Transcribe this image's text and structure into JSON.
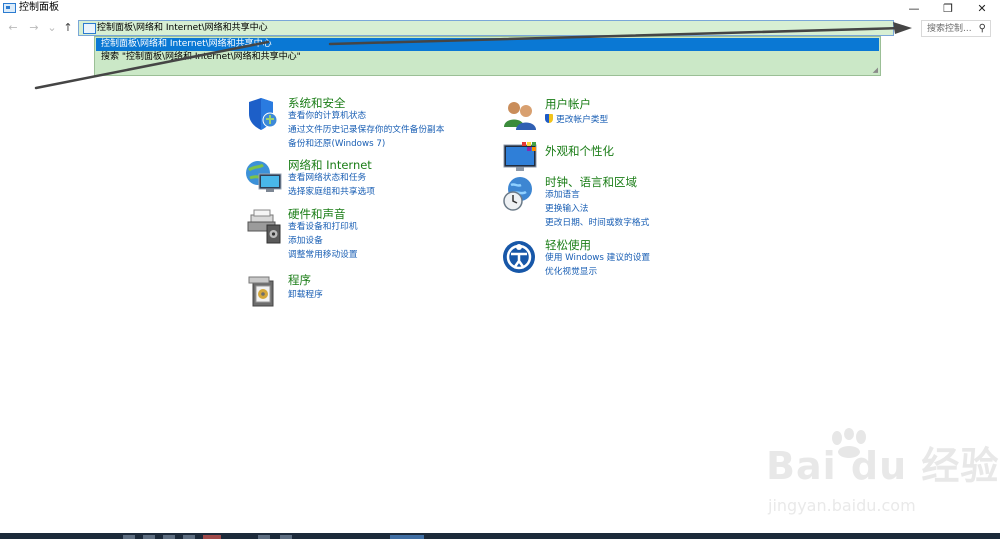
{
  "window": {
    "title": "控制面板",
    "minimize_glyph": "—",
    "maximize_glyph": "❐",
    "close_glyph": "✕"
  },
  "nav": {
    "back_glyph": "←",
    "forward_glyph": "→",
    "history_glyph": "⌄",
    "up_glyph": "↑"
  },
  "address_bar": {
    "path": "控制面板\\网络和 Internet\\网络和共享中心",
    "go_glyph": "→"
  },
  "search": {
    "placeholder": "搜索控制...",
    "icon_glyph": "⚲"
  },
  "autocomplete": {
    "items": [
      "控制面板\\网络和 Internet\\网络和共享中心",
      "搜索 \"控制面板\\网络和 Internet\\网络和共享中心\""
    ],
    "grip_glyph": "◢"
  },
  "colors": {
    "category_title": "#1a7d16",
    "link": "#1a5fb4",
    "address_bg": "#d7efd3",
    "dropdown_bg": "#cbe8c7",
    "selection": "#0a78d4"
  },
  "categories_left": [
    {
      "title": "系统和安全",
      "icon": "system-security-icon",
      "links": [
        "查看你的计算机状态",
        "通过文件历史记录保存你的文件备份副本",
        "备份和还原(Windows 7)"
      ]
    },
    {
      "title": "网络和 Internet",
      "icon": "network-internet-icon",
      "links": [
        "查看网络状态和任务",
        "选择家庭组和共享选项"
      ]
    },
    {
      "title": "硬件和声音",
      "icon": "hardware-sound-icon",
      "links": [
        "查看设备和打印机",
        "添加设备",
        "调整常用移动设置"
      ]
    },
    {
      "title": "程序",
      "icon": "programs-icon",
      "links": [
        "卸载程序"
      ]
    }
  ],
  "categories_right": [
    {
      "title": "用户帐户",
      "icon": "user-accounts-icon",
      "links": [
        "更改帐户类型"
      ]
    },
    {
      "title": "外观和个性化",
      "icon": "appearance-icon",
      "links": []
    },
    {
      "title": "时钟、语言和区域",
      "icon": "clock-language-icon",
      "links": [
        "添加语言",
        "更换输入法",
        "更改日期、时间或数字格式"
      ]
    },
    {
      "title": "轻松使用",
      "icon": "ease-of-access-icon",
      "links": [
        "使用 Windows 建议的设置",
        "优化视觉显示"
      ]
    }
  ],
  "watermark": {
    "brand": "Bai du 经验",
    "url": "jingyan.baidu.com"
  }
}
